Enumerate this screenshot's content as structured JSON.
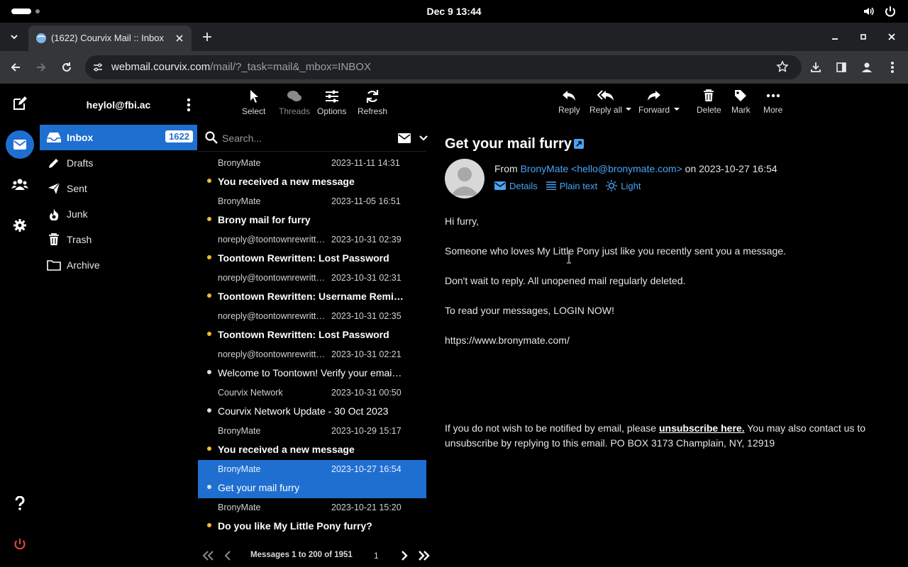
{
  "system": {
    "clock": "Dec 9  13:44",
    "volume_icon": "volume-icon",
    "power_icon": "power-icon"
  },
  "browser": {
    "tab_title": "(1622) Courvix Mail :: Inbox",
    "url_host": "webmail.courvix.com",
    "url_path": "/mail/?_task=mail&_mbox=INBOX"
  },
  "account": {
    "email": "heylol@fbi.ac"
  },
  "folders": [
    {
      "label": "Inbox",
      "count": "1622",
      "icon": "inbox-icon"
    },
    {
      "label": "Drafts",
      "icon": "pencil-icon"
    },
    {
      "label": "Sent",
      "icon": "paper-plane-icon"
    },
    {
      "label": "Junk",
      "icon": "fire-icon"
    },
    {
      "label": "Trash",
      "icon": "trash-icon"
    },
    {
      "label": "Archive",
      "icon": "folder-icon"
    }
  ],
  "list_toolbar": {
    "select": "Select",
    "threads": "Threads",
    "options": "Options",
    "refresh": "Refresh"
  },
  "search": {
    "placeholder": "Search..."
  },
  "messages": [
    {
      "from": "BronyMate",
      "date": "2023-11-11 14:31",
      "subject": "You received a new message",
      "unread": true
    },
    {
      "from": "BronyMate",
      "date": "2023-11-05 16:51",
      "subject": "Brony mail for furry",
      "unread": true
    },
    {
      "from": "noreply@toontownrewritten.com",
      "date": "2023-10-31 02:39",
      "subject": "Toontown Rewritten: Lost Password",
      "unread": true
    },
    {
      "from": "noreply@toontownrewritten.com",
      "date": "2023-10-31 02:31",
      "subject": "Toontown Rewritten: Username Reminder",
      "unread": true
    },
    {
      "from": "noreply@toontownrewritten.com",
      "date": "2023-10-31 02:35",
      "subject": "Toontown Rewritten: Lost Password",
      "unread": true
    },
    {
      "from": "noreply@toontownrewritten.com",
      "date": "2023-10-31 02:21",
      "subject": "Welcome to Toontown! Verify your email address",
      "unread": false
    },
    {
      "from": "Courvix Network",
      "date": "2023-10-31 00:50",
      "subject": "Courvix Network Update - 30 Oct 2023",
      "unread": false
    },
    {
      "from": "BronyMate",
      "date": "2023-10-29 15:17",
      "subject": "You received a new message",
      "unread": true
    },
    {
      "from": "BronyMate",
      "date": "2023-10-27 16:54",
      "subject": "Get your mail furry",
      "unread": false,
      "selected": true
    },
    {
      "from": "BronyMate",
      "date": "2023-10-21 15:20",
      "subject": "Do you like My Little Pony furry?",
      "unread": true
    }
  ],
  "pager": {
    "text": "Messages 1 to 200 of 1951",
    "page": "1"
  },
  "reader_toolbar": {
    "reply": "Reply",
    "reply_all": "Reply all",
    "forward": "Forward",
    "delete": "Delete",
    "mark": "Mark",
    "more": "More"
  },
  "mail": {
    "subject": "Get your mail furry",
    "from_prefix": "From ",
    "from_name": "BronyMate <hello@bronymate.com>",
    "from_suffix": " on 2023-10-27 16:54",
    "links": {
      "details": "Details",
      "plain": "Plain text",
      "light": "Light"
    },
    "body": [
      "Hi furry,",
      "Someone who loves My Little Pony just like you recently sent you a message.",
      "Don't wait to reply. All unopened mail regularly deleted.",
      "To read your messages, LOGIN NOW!",
      "https://www.bronymate.com/"
    ],
    "footer_pre": "If you do not wish to be notified by email, please ",
    "footer_link": "unsubscribe here.",
    "footer_post": " You may also contact us to unsubscribe by replying to this email. PO BOX 3173 Champlain, NY, 12919"
  },
  "colors": {
    "accent": "#1f6fd1",
    "link": "#4ba3f5",
    "unread_dot": "#f5b82e",
    "logout": "#e0453a"
  }
}
